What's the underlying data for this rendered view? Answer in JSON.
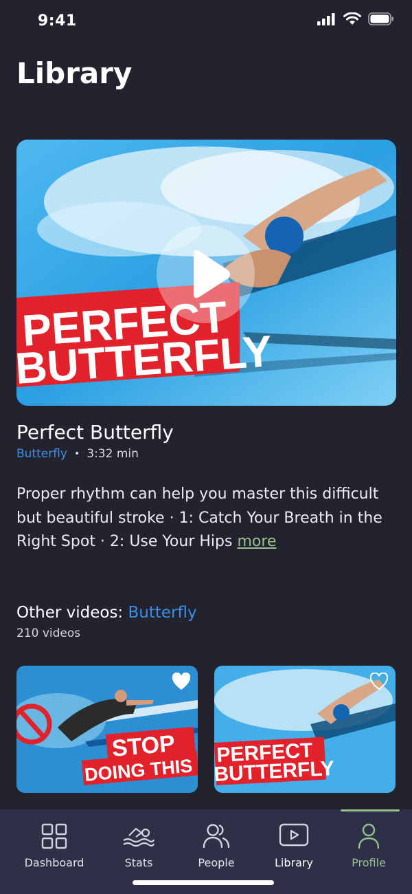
{
  "status_bar": {
    "time": "9:41"
  },
  "page": {
    "title": "Library"
  },
  "featured": {
    "thumbnail_text": [
      "PERFECT",
      "BUTTERFLY"
    ],
    "title": "Perfect Butterfly",
    "category": "Butterfly",
    "separator": "•",
    "duration": "3:32 min",
    "description": "Proper rhythm can help you master this difficult but beautiful stroke · 1: Catch Your Breath in the Right Spot · 2: Use Your Hips",
    "more_label": "more"
  },
  "other_videos": {
    "heading_prefix": "Other videos:",
    "heading_category": "Butterfly",
    "count": "210 videos",
    "items": [
      {
        "overlay_text": [
          "STOP",
          "DOING THIS"
        ],
        "favorited": true
      },
      {
        "overlay_text": [
          "PERFECT",
          "BUTTERFLY"
        ],
        "favorited": false
      }
    ]
  },
  "tab_bar": {
    "tabs": [
      {
        "label": "Dashboard",
        "icon": "grid-icon"
      },
      {
        "label": "Stats",
        "icon": "swimmer-icon"
      },
      {
        "label": "People",
        "icon": "people-icon"
      },
      {
        "label": "Library",
        "icon": "play-box-icon"
      },
      {
        "label": "Profile",
        "icon": "person-icon"
      }
    ],
    "active_tab": "Profile"
  },
  "colors": {
    "background": "#22232f",
    "tab_bar": "#2d3047",
    "accent_blue": "#3b8ee5",
    "accent_green": "#95c28d",
    "banner_red": "#e2212b"
  }
}
